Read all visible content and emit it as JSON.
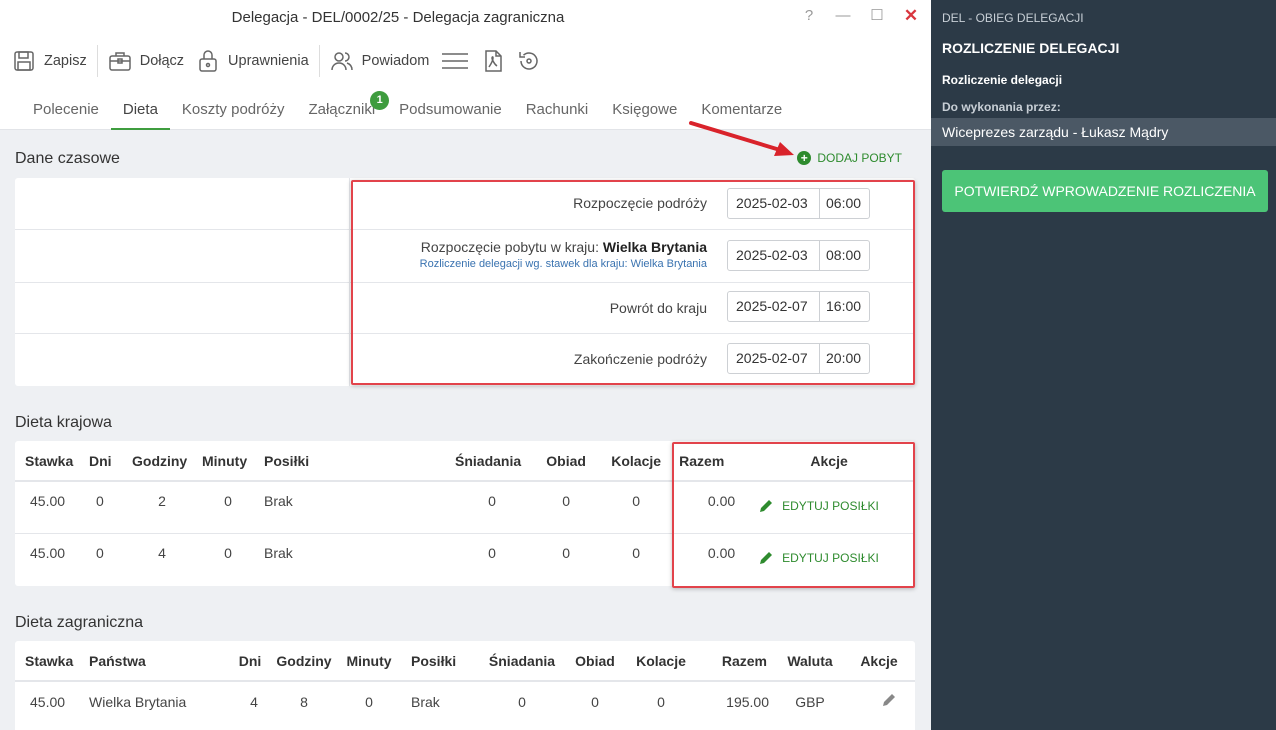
{
  "window": {
    "title": "Delegacja - DEL/0002/25 - Delegacja zagraniczna",
    "help": "?",
    "minimize": "—",
    "maximize": "☐",
    "close": "✕"
  },
  "toolbar": {
    "save_label": "Zapisz",
    "attach_label": "Dołącz",
    "permissions_label": "Uprawnienia",
    "notify_label": "Powiadom",
    "icons": [
      "save-icon",
      "briefcase-icon",
      "lock-icon",
      "users-icon",
      "menu-icon",
      "pdf-icon",
      "history-icon"
    ]
  },
  "tabs": [
    {
      "label": "Polecenie"
    },
    {
      "label": "Dieta",
      "active": true
    },
    {
      "label": "Koszty podróży"
    },
    {
      "label": "Załączniki",
      "badge": "1"
    },
    {
      "label": "Podsumowanie"
    },
    {
      "label": "Rachunki"
    },
    {
      "label": "Księgowe"
    },
    {
      "label": "Komentarze"
    }
  ],
  "time_section": {
    "title": "Dane czasowe",
    "add_stay": "DODAJ POBYT",
    "rows": [
      {
        "label": "Rozpoczęcie podróży",
        "date": "2025-02-03",
        "time": "06:00"
      },
      {
        "label_prefix": "Rozpoczęcie pobytu w kraju: ",
        "label_bold": "Wielka Brytania",
        "sub": "Rozliczenie delegacji wg. stawek dla kraju: Wielka Brytania",
        "date": "2025-02-03",
        "time": "08:00"
      },
      {
        "label": "Powrót do kraju",
        "date": "2025-02-07",
        "time": "16:00"
      },
      {
        "label": "Zakończenie podróży",
        "date": "2025-02-07",
        "time": "20:00"
      }
    ]
  },
  "domestic": {
    "title": "Dieta krajowa",
    "headers": [
      "Stawka",
      "Dni",
      "Godziny",
      "Minuty",
      "Posiłki",
      "Śniadania",
      "Obiad",
      "Kolacje",
      "Razem",
      "Akcje"
    ],
    "rows": [
      {
        "stawka": "45.00",
        "dni": "0",
        "godziny": "2",
        "minuty": "0",
        "posilki": "Brak",
        "sniadania": "0",
        "obiad": "0",
        "kolacje": "0",
        "razem": "0.00",
        "action": "EDYTUJ POSIŁKI"
      },
      {
        "stawka": "45.00",
        "dni": "0",
        "godziny": "4",
        "minuty": "0",
        "posilki": "Brak",
        "sniadania": "0",
        "obiad": "0",
        "kolacje": "0",
        "razem": "0.00",
        "action": "EDYTUJ POSIŁKI"
      }
    ]
  },
  "foreign": {
    "title": "Dieta zagraniczna",
    "headers": [
      "Stawka",
      "Państwa",
      "Dni",
      "Godziny",
      "Minuty",
      "Posiłki",
      "Śniadania",
      "Obiad",
      "Kolacje",
      "Razem",
      "Waluta",
      "Akcje"
    ],
    "rows": [
      {
        "stawka": "45.00",
        "panstwa": "Wielka Brytania",
        "dni": "4",
        "godziny": "8",
        "minuty": "0",
        "posilki": "Brak",
        "sniadania": "0",
        "obiad": "0",
        "kolacje": "0",
        "razem": "195.00",
        "waluta": "GBP"
      }
    ]
  },
  "sidebar": {
    "workflow": "DEL - OBIEG DELEGACJI",
    "step_title": "ROZLICZENIE DELEGACJI",
    "step_name": "Rozliczenie delegacji",
    "assigned_label": "Do wykonania przez:",
    "assignee": "Wiceprezes zarządu - Łukasz Mądry",
    "confirm_button": "POTWIERDŹ WPROWADZENIE ROZLICZENIA"
  },
  "colors": {
    "accent_green": "#3e9c3e",
    "confirm_green": "#4cc477",
    "highlight_red": "#e2434b",
    "sidebar_bg": "#2c3a47"
  }
}
